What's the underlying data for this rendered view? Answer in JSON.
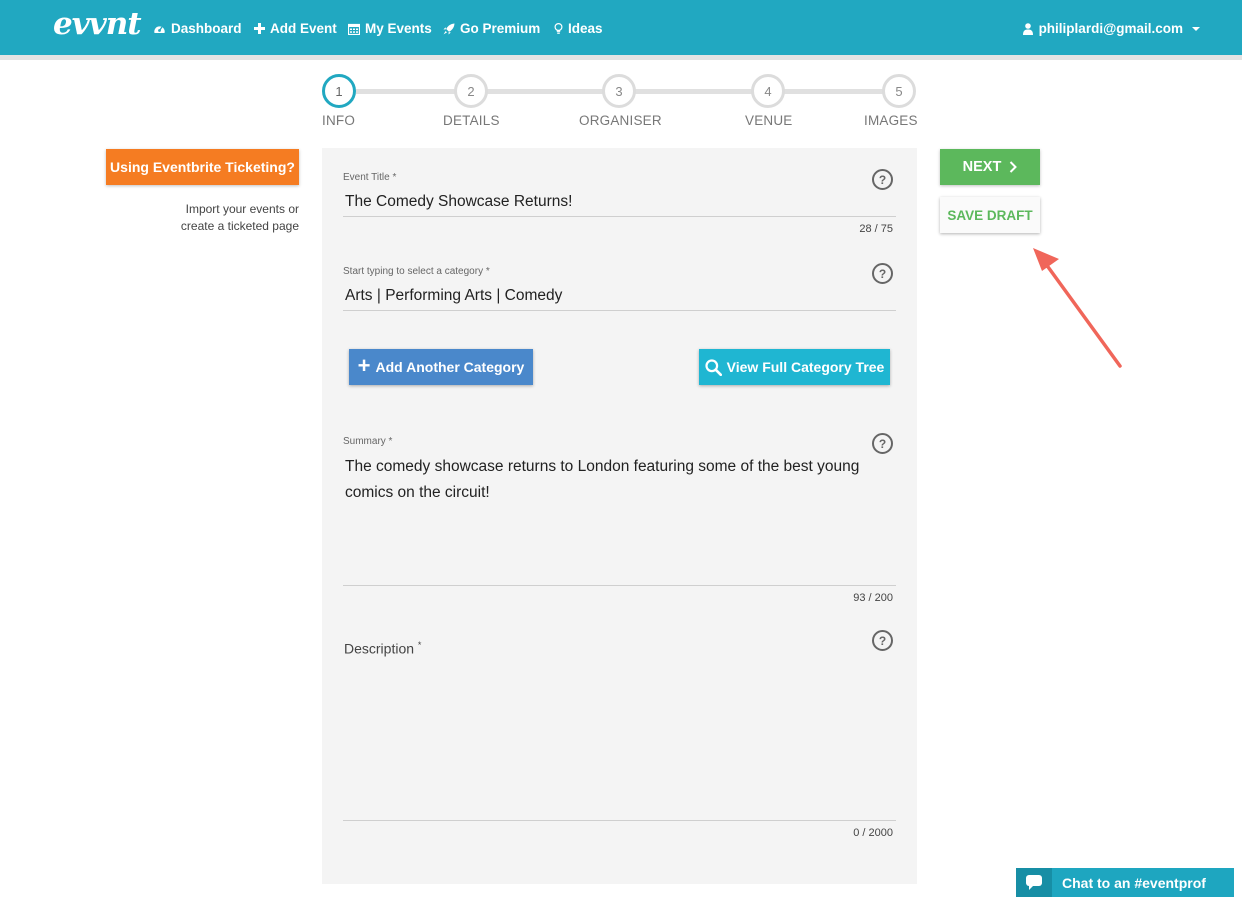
{
  "nav": {
    "logo": "evvnt",
    "items": [
      {
        "label": "Dashboard",
        "icon": "dashboard-icon"
      },
      {
        "label": "Add Event",
        "icon": "plus-icon"
      },
      {
        "label": "My Events",
        "icon": "calendar-icon"
      },
      {
        "label": "Go Premium",
        "icon": "rocket-icon"
      },
      {
        "label": "Ideas",
        "icon": "lightbulb-icon"
      }
    ],
    "user_email": "philiplardi@gmail.com"
  },
  "stepper": {
    "current_step": 1,
    "steps": [
      {
        "number": "1",
        "label": "INFO"
      },
      {
        "number": "2",
        "label": "DETAILS"
      },
      {
        "number": "3",
        "label": "ORGANISER"
      },
      {
        "number": "4",
        "label": "VENUE"
      },
      {
        "number": "5",
        "label": "IMAGES"
      }
    ]
  },
  "eventbrite": {
    "button_label": "Using Eventbrite Ticketing?",
    "help_line1": "Import your events or",
    "help_line2": "create a ticketed page"
  },
  "form": {
    "title": {
      "label": "Event Title *",
      "value": "The Comedy Showcase Returns!",
      "counter": "28 / 75"
    },
    "category": {
      "label": "Start typing to select a category *",
      "value": "Arts | Performing Arts | Comedy"
    },
    "add_category_label": "Add Another Category",
    "view_tree_label": "View Full Category Tree",
    "summary": {
      "label": "Summary *",
      "value": "The comedy showcase returns to London featuring some of the best young comics on the circuit!",
      "counter": "93 / 200"
    },
    "description": {
      "label": "Description",
      "required_mark": "*",
      "value": "",
      "counter": "0 / 2000"
    },
    "help_glyph": "?"
  },
  "actions": {
    "next_label": "NEXT",
    "save_draft_label": "SAVE DRAFT"
  },
  "chat": {
    "label": "Chat to an #eventprof"
  },
  "colors": {
    "navbar": "#21a8c1",
    "orange": "#f57c22",
    "green": "#5cb85c",
    "blue_button": "#4a88cb",
    "cyan_button": "#1fb6d2",
    "annotation_arrow": "#f0665a"
  }
}
